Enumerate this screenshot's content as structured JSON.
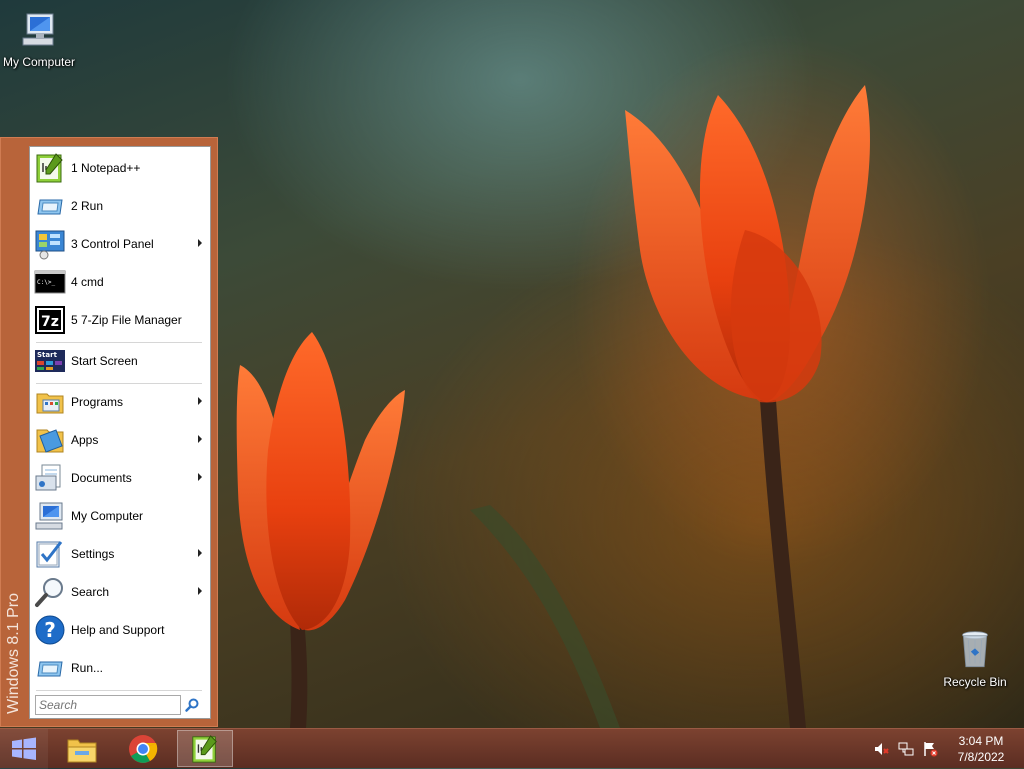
{
  "desktop": {
    "icons": [
      {
        "label": "My Computer",
        "icon": "my-computer-icon"
      },
      {
        "label": "Recycle Bin",
        "icon": "recycle-bin-icon"
      }
    ]
  },
  "start_menu": {
    "banner": "Windows 8.1 Pro",
    "items": [
      {
        "label": "1 Notepad++",
        "icon": "notepadpp-icon",
        "submenu": false
      },
      {
        "label": "2 Run",
        "icon": "run-icon",
        "submenu": false
      },
      {
        "label": "3 Control Panel",
        "icon": "control-panel-icon",
        "submenu": true
      },
      {
        "label": "4 cmd",
        "icon": "cmd-icon",
        "submenu": false
      },
      {
        "label": "5 7-Zip File Manager",
        "icon": "seven-zip-icon",
        "submenu": false
      },
      {
        "label": "Start Screen",
        "icon": "start-screen-icon",
        "submenu": false
      },
      {
        "label": "Programs",
        "icon": "programs-icon",
        "submenu": true
      },
      {
        "label": "Apps",
        "icon": "apps-icon",
        "submenu": true
      },
      {
        "label": "Documents",
        "icon": "documents-icon",
        "submenu": true
      },
      {
        "label": "My Computer",
        "icon": "my-computer-icon",
        "submenu": false
      },
      {
        "label": "Settings",
        "icon": "settings-icon",
        "submenu": true
      },
      {
        "label": "Search",
        "icon": "search-icon",
        "submenu": true
      },
      {
        "label": "Help and Support",
        "icon": "help-icon",
        "submenu": false
      },
      {
        "label": "Run...",
        "icon": "run-icon",
        "submenu": false
      }
    ],
    "search_placeholder": "Search",
    "cmd_icon_text": "C:\\>_",
    "start_icon_text": "Start",
    "seven_zip_text": "7z"
  },
  "taskbar": {
    "buttons": [
      {
        "icon": "file-explorer-icon",
        "active": false
      },
      {
        "icon": "chrome-icon",
        "active": false
      },
      {
        "icon": "notepadpp-icon",
        "active": true
      }
    ],
    "tray": [
      "speaker-muted-icon",
      "network-icon",
      "action-center-icon"
    ],
    "time": "3:04 PM",
    "date": "7/8/2022"
  },
  "colors": {
    "start_menu_border": "#b8643a",
    "taskbar": "#6b372a"
  }
}
